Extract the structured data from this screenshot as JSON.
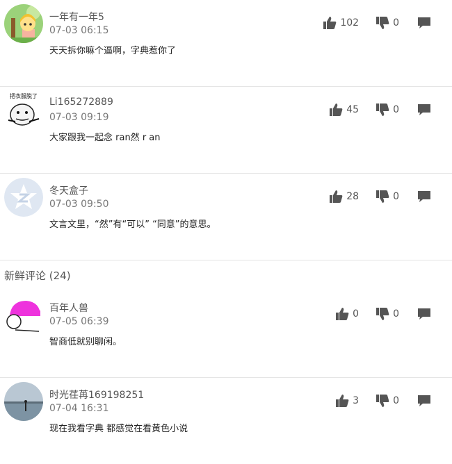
{
  "hot_comments": [
    {
      "user": "一年有一年5",
      "time": "07-03 06:15",
      "text": "天天拆你嘛个逼啊，字典惹你了",
      "likes": "102",
      "dislikes": "0",
      "avatar_icon": "cartoon-avatar-icon"
    },
    {
      "user": "Li165272889",
      "time": "07-03 09:19",
      "text": "大家跟我一起念 ran然 r an",
      "likes": "45",
      "dislikes": "0",
      "avatar_icon": "meme-avatar-icon",
      "avatar_caption": "把衣服脱了"
    },
    {
      "user": "冬天盒子",
      "time": "07-03 09:50",
      "text": "文言文里，“然”有“可以”  “同意”的意思。",
      "likes": "28",
      "dislikes": "0",
      "avatar_icon": "default-avatar-icon"
    }
  ],
  "fresh_section": {
    "title": "新鲜评论 (24)"
  },
  "fresh_comments": [
    {
      "user": "百年人兽",
      "time": "07-05 06:39",
      "text": "智商低就别聊闲。",
      "likes": "0",
      "dislikes": "0",
      "avatar_icon": "pink-cap-avatar-icon"
    },
    {
      "user": "时光荏苒169198251",
      "time": "07-04 16:31",
      "text": "现在我看字典 都感觉在看黄色小说",
      "likes": "3",
      "dislikes": "0",
      "avatar_icon": "lake-photo-avatar-icon"
    }
  ],
  "colors": {
    "icon": "#555555",
    "divider": "#e5e5e5",
    "pink": "#ee33dd",
    "default_avatar": "#dfe7f2"
  }
}
